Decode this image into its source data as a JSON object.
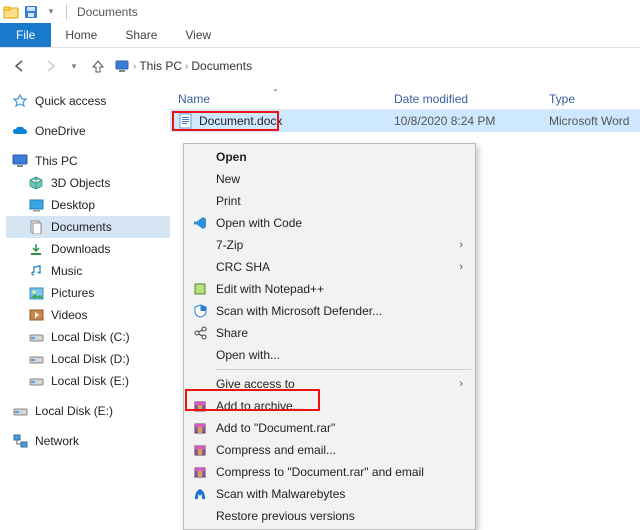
{
  "titlebar": {
    "title": "Documents"
  },
  "ribbon": {
    "file": "File",
    "home": "Home",
    "share": "Share",
    "view": "View"
  },
  "breadcrumb": {
    "root": "This PC",
    "folder": "Documents"
  },
  "columns": {
    "name": "Name",
    "date": "Date modified",
    "type": "Type"
  },
  "file": {
    "name": "Document.docx",
    "date": "10/8/2020 8:24 PM",
    "type": "Microsoft Word"
  },
  "sidebar": {
    "quick": "Quick access",
    "onedrive": "OneDrive",
    "thispc": "This PC",
    "objects3d": "3D Objects",
    "desktop": "Desktop",
    "documents": "Documents",
    "downloads": "Downloads",
    "music": "Music",
    "pictures": "Pictures",
    "videos": "Videos",
    "localc": "Local Disk (C:)",
    "locald": "Local Disk (D:)",
    "locale1": "Local Disk (E:)",
    "locale2": "Local Disk (E:)",
    "network": "Network"
  },
  "ctx": {
    "open": "Open",
    "new": "New",
    "print": "Print",
    "openwithcode": "Open with Code",
    "sevenzip": "7-Zip",
    "crcsha": "CRC SHA",
    "notepadpp": "Edit with Notepad++",
    "defender": "Scan with Microsoft Defender...",
    "share": "Share",
    "openwith": "Open with...",
    "giveaccess": "Give access to",
    "addarchive": "Add to archive...",
    "addrar": "Add to \"Document.rar\"",
    "compressemail": "Compress and email...",
    "compressrare": "Compress to \"Document.rar\" and email",
    "malwarebytes": "Scan with Malwarebytes",
    "restoreprev": "Restore previous versions"
  }
}
